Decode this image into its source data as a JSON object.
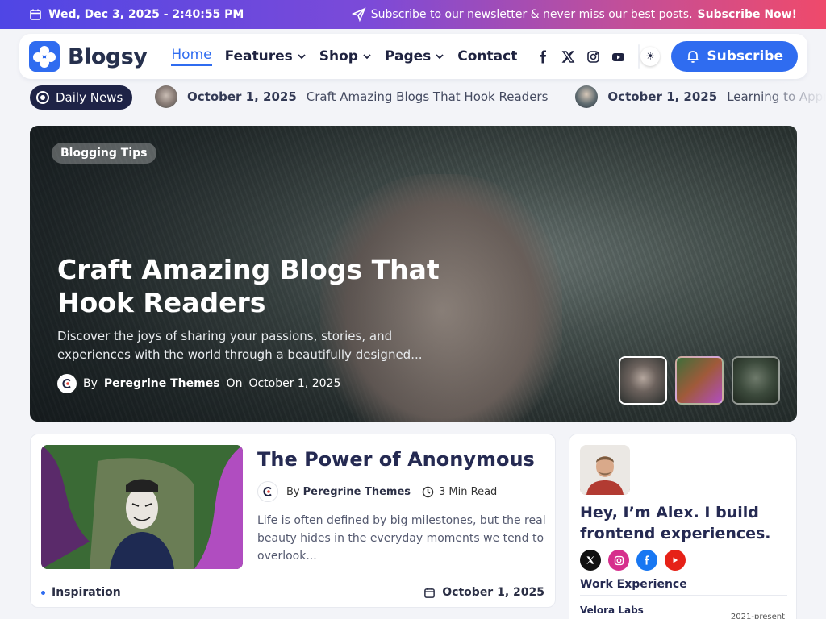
{
  "topbar": {
    "datetime": "Wed, Dec 3, 2025 - 2:40:55 PM",
    "newsletter_text": "Subscribe to our newsletter & never miss our best posts.",
    "newsletter_cta": "Subscribe Now!"
  },
  "header": {
    "logo_text": "Blogsy",
    "nav": [
      {
        "label": "Home"
      },
      {
        "label": "Features"
      },
      {
        "label": "Shop"
      },
      {
        "label": "Pages"
      },
      {
        "label": "Contact"
      }
    ],
    "social_icons": [
      "facebook-icon",
      "x-icon",
      "instagram-icon",
      "youtube-icon"
    ],
    "theme_toggle_icon": "☀",
    "subscribe_label": "Subscribe"
  },
  "ticker": {
    "badge": "Daily News",
    "items": [
      {
        "date": "October 1, 2025",
        "title": "Craft Amazing Blogs That Hook Readers"
      },
      {
        "date": "October 1, 2025",
        "title": "Learning to Appr"
      }
    ]
  },
  "hero": {
    "category": "Blogging Tips",
    "title": "Craft Amazing Blogs That Hook Readers",
    "excerpt": "Discover the joys of sharing your passions, stories, and experiences with the world through a beautifully designed...",
    "by": "By",
    "author": "Peregrine Themes",
    "on": "On",
    "date": "October 1, 2025"
  },
  "article": {
    "title": "The Power of Anonymous",
    "by": "By",
    "author": "Peregrine Themes",
    "read_time": "3 Min Read",
    "excerpt": "Life is often defined by big milestones, but the real beauty hides in the everyday moments we tend to overlook...",
    "category": "Inspiration",
    "date": "October 1, 2025"
  },
  "sidebar": {
    "title": "Hey, I’m Alex. I build frontend experiences.",
    "socials": [
      "x-icon",
      "instagram-icon",
      "facebook-icon",
      "youtube-icon"
    ],
    "work_heading": "Work Experience",
    "job": "Velora Labs",
    "years": "2021-present"
  },
  "colors": {
    "accent": "#2f6cf0",
    "heading": "#252a52",
    "ticker_badge": "#1e2346"
  }
}
